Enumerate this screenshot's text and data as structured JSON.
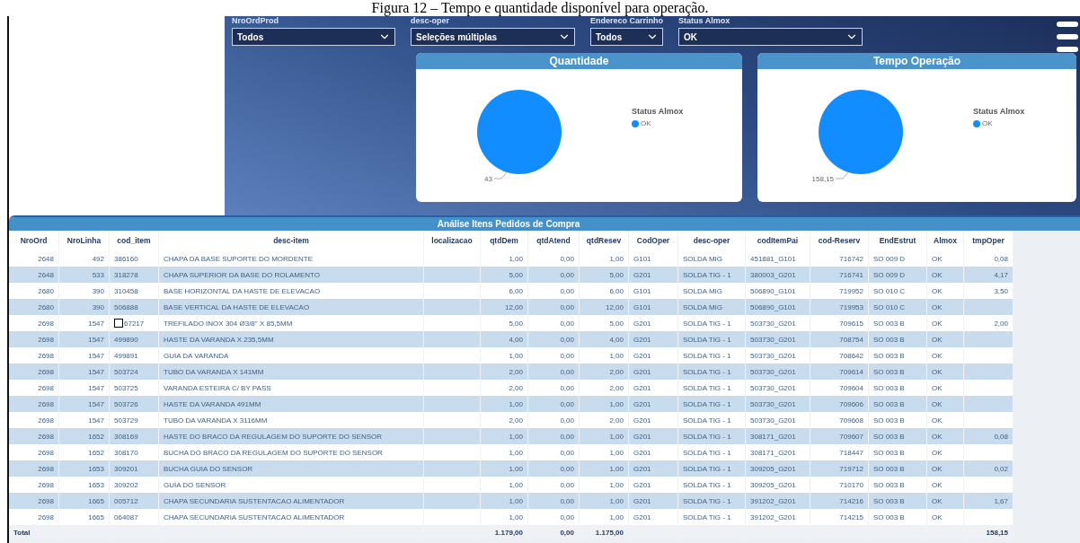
{
  "caption": "Figura 12 – Tempo e quantidade disponível para operação.",
  "filters": [
    {
      "label": "NroOrdProd",
      "value": "Todos"
    },
    {
      "label": "desc-oper",
      "value": "Seleções múltiplas"
    },
    {
      "label": "Endereco Carrinho",
      "value": "Todos"
    },
    {
      "label": "Status Almox",
      "value": "OK"
    }
  ],
  "charts": [
    {
      "title": "Quantidade",
      "value_label": "43",
      "legend_title": "Status Almox",
      "legend": [
        {
          "label": "OK",
          "color": "#118dff"
        }
      ]
    },
    {
      "title": "Tempo Operação",
      "value_label": "158,15",
      "legend_title": "Status Almox",
      "legend": [
        {
          "label": "OK",
          "color": "#118dff"
        }
      ]
    }
  ],
  "table": {
    "title": "Análise Itens Pedidos de Compra",
    "columns": [
      "NroOrd",
      "NroLinha",
      "cod_item",
      "desc-item",
      "localizacao",
      "qtdDem",
      "qtdAtend",
      "qtdResev",
      "CodOper",
      "desc-oper",
      "codItemPai",
      "cod-Reserv",
      "EndEstrut",
      "Almox",
      "tmpOper"
    ],
    "rows": [
      {
        "cells": [
          "2648",
          "492",
          "386160",
          "CHAPA DA BASE SUPORTE DO MORDENTE",
          null,
          "1,00",
          "0,00",
          "1,00",
          "G101",
          "SOLDA MIG",
          "451881_G101",
          "716742",
          "SO 009 D",
          "OK",
          "0,08"
        ]
      },
      {
        "cells": [
          "2648",
          "533",
          "318278",
          "CHAPA SUPERIOR DA BASE DO ROLAMENTO",
          null,
          "5,00",
          "0,00",
          "5,00",
          "G201",
          "SOLDA TIG - 1",
          "380003_G201",
          "716741",
          "SO 009 D",
          "OK",
          "4,17"
        ]
      },
      {
        "cells": [
          "2680",
          "390",
          "310458",
          "BASE HORIZONTAL DA HASTE DE ELEVACAO",
          null,
          "6,00",
          "0,00",
          "6,00",
          "G101",
          "SOLDA MIG",
          "506890_G101",
          "719952",
          "SO 010 C",
          "OK",
          "3,50"
        ]
      },
      {
        "cells": [
          "2680",
          "390",
          "506888",
          "BASE VERTICAL DA HASTE DE ELEVACAO",
          null,
          "12,00",
          "0,00",
          "12,00",
          "G101",
          "SOLDA MIG",
          "506890_G101",
          "719953",
          "SO 010 C",
          "OK",
          null
        ]
      },
      {
        "cursor": true,
        "cells": [
          "2698",
          "1547",
          "67217",
          "TREFILADO INOX 304 Ø3/8\" X 85,5MM",
          null,
          "5,00",
          "0,00",
          "5,00",
          "G201",
          "SOLDA TIG - 1",
          "503730_G201",
          "709615",
          "SO 003 B",
          "OK",
          "2,00"
        ]
      },
      {
        "cells": [
          "2698",
          "1547",
          "499890",
          "HASTE DA VARANDA X 235,5MM",
          null,
          "4,00",
          "0,00",
          "4,00",
          "G201",
          "SOLDA TIG - 1",
          "503730_G201",
          "708754",
          "SO 003 B",
          "OK",
          null
        ]
      },
      {
        "cells": [
          "2698",
          "1547",
          "499891",
          "GUIA DA VARANDA",
          null,
          "1,00",
          "0,00",
          "1,00",
          "G201",
          "SOLDA TIG - 1",
          "503730_G201",
          "708642",
          "SO 003 B",
          "OK",
          null
        ]
      },
      {
        "cells": [
          "2698",
          "1547",
          "503724",
          "TUBO DA VARANDA X 141MM",
          null,
          "2,00",
          "0,00",
          "2,00",
          "G201",
          "SOLDA TIG - 1",
          "503730_G201",
          "709614",
          "SO 003 B",
          "OK",
          null
        ]
      },
      {
        "cells": [
          "2698",
          "1547",
          "503725",
          "VARANDA ESTEIRA C/ BY PASS",
          null,
          "2,00",
          "0,00",
          "2,00",
          "G201",
          "SOLDA TIG - 1",
          "503730_G201",
          "709604",
          "SO 003 B",
          "OK",
          null
        ]
      },
      {
        "cells": [
          "2698",
          "1547",
          "503726",
          "HASTE DA VARANDA 491MM",
          null,
          "1,00",
          "0,00",
          "1,00",
          "G201",
          "SOLDA TIG - 1",
          "503730_G201",
          "709606",
          "SO 003 B",
          "OK",
          null
        ]
      },
      {
        "cells": [
          "2698",
          "1547",
          "503729",
          "TUBO DA VARANDA X 3116MM",
          null,
          "2,00",
          "0,00",
          "2,00",
          "G201",
          "SOLDA TIG - 1",
          "503730_G201",
          "709608",
          "SO 003 B",
          "OK",
          null
        ]
      },
      {
        "cells": [
          "2698",
          "1652",
          "308169",
          "HASTE DO BRACO DA REGULAGEM DO SUPORTE DO SENSOR",
          null,
          "1,00",
          "0,00",
          "1,00",
          "G201",
          "SOLDA TIG - 1",
          "308171_G201",
          "709607",
          "SO 003 B",
          "OK",
          "0,08"
        ]
      },
      {
        "cells": [
          "2698",
          "1652",
          "308170",
          "BUCHA DO BRACO DA REGULAGEM DO SUPORTE DO SENSOR",
          null,
          "1,00",
          "0,00",
          "1,00",
          "G201",
          "SOLDA TIG - 1",
          "308171_G201",
          "718447",
          "SO 003 B",
          "OK",
          null
        ]
      },
      {
        "cells": [
          "2698",
          "1653",
          "309201",
          "BUCHA GUIA DO SENSOR",
          null,
          "1,00",
          "0,00",
          "1,00",
          "G201",
          "SOLDA TIG - 1",
          "309205_G201",
          "719712",
          "SO 003 B",
          "OK",
          "0,02"
        ]
      },
      {
        "cells": [
          "2698",
          "1653",
          "309202",
          "GUIA DO SENSOR",
          null,
          "1,00",
          "0,00",
          "1,00",
          "G201",
          "SOLDA TIG - 1",
          "309205_G201",
          "710170",
          "SO 003 B",
          "OK",
          null
        ]
      },
      {
        "cells": [
          "2698",
          "1665",
          "005712",
          "CHAPA SECUNDARIA SUSTENTACAO ALIMENTADOR",
          null,
          "1,00",
          "0,00",
          "1,00",
          "G201",
          "SOLDA TIG - 1",
          "391202_G201",
          "714216",
          "SO 003 B",
          "OK",
          "1,67"
        ]
      },
      {
        "cells": [
          "2698",
          "1665",
          "064087",
          "CHAPA SECUNDARIA SUSTENTACAO ALIMENTADOR",
          null,
          "1,00",
          "0,00",
          "1,00",
          "G201",
          "SOLDA TIG - 1",
          "391202_G201",
          "714215",
          "SO 003 B",
          "OK",
          null
        ]
      }
    ],
    "total": {
      "label": "Total",
      "cells": {
        "5": "1.179,00",
        "6": "0,00",
        "7": "1.175,00",
        "14": "158,15"
      }
    }
  }
}
